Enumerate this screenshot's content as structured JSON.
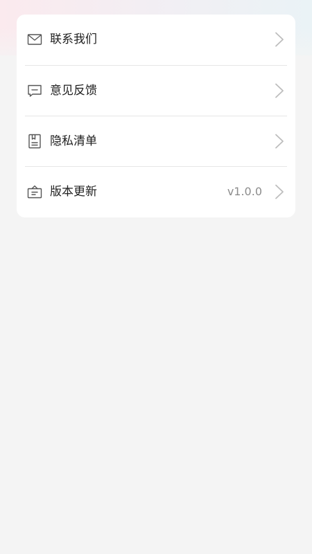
{
  "colors": {
    "card_background": "#ffffff",
    "page_background": "#f4f4f4",
    "label_text": "#1f1f1f",
    "value_text": "#8c8c8c",
    "icon_stroke": "#555555",
    "chevron_stroke": "#bdbdbd",
    "divider": "#e6e6e6"
  },
  "settings_list": {
    "items": [
      {
        "label": "联系我们",
        "icon": "mail-icon",
        "value": ""
      },
      {
        "label": "意见反馈",
        "icon": "feedback-chat-icon",
        "value": ""
      },
      {
        "label": "隐私清单",
        "icon": "privacy-document-icon",
        "value": ""
      },
      {
        "label": "版本更新",
        "icon": "update-box-icon",
        "value": "v1.0.0"
      }
    ]
  }
}
